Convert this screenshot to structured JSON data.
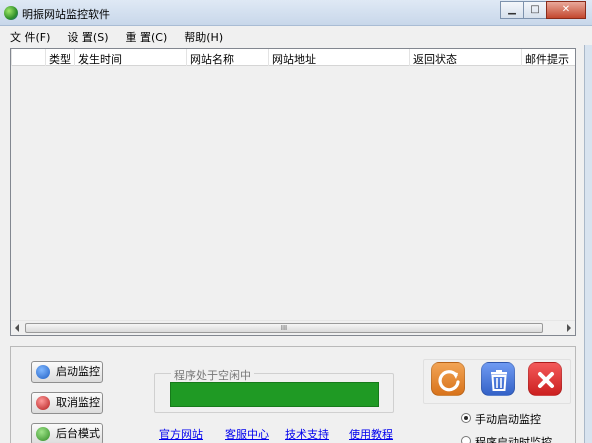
{
  "window": {
    "title": "明振网站监控软件",
    "minimize_glyph": "▁",
    "maximize_glyph": "□",
    "close_glyph": "✕"
  },
  "menu": [
    "文 件(F)",
    "设 置(S)",
    "重 置(C)",
    "帮助(H)"
  ],
  "table": {
    "columns": [
      "类型",
      "发生时间",
      "网站名称",
      "网站地址",
      "返回状态",
      "邮件提示"
    ],
    "rows": [],
    "scroll_thumb_glyph": "III"
  },
  "buttons": {
    "start": "启动监控",
    "cancel": "取消监控",
    "background": "后台模式"
  },
  "status": {
    "label": "程序处于空闲中",
    "progress": 1.0
  },
  "links": [
    "官方网站",
    "客服中心",
    "技术支持",
    "使用教程"
  ],
  "actions": {
    "refresh_icon": "refresh-icon",
    "delete_icon": "trash-icon",
    "close_icon": "close-x-icon"
  },
  "radios": [
    {
      "label": "手动启动监控",
      "selected": true
    },
    {
      "label": "程序启动时监控",
      "selected": false
    }
  ],
  "colors": {
    "progress_fill": "#1f9a24",
    "link": "#0000ee",
    "refresh_tile": "#e58b34",
    "delete_tile": "#4a79de",
    "close_tile": "#e23b3b"
  }
}
